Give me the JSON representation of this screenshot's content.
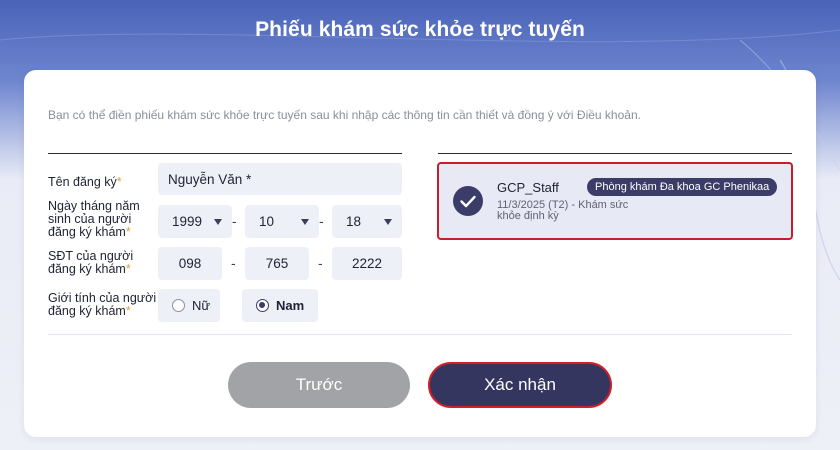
{
  "page": {
    "title": "Phiếu khám sức khỏe trực tuyến",
    "intro": "Bạn có thể điền phiếu khám sức khỏe trực tuyến sau khi nhập các thông tin cần thiết và đồng ý với Điều khoản."
  },
  "form": {
    "name_label": "Tên đăng ký",
    "name_value": "Nguyễn Văn *",
    "dob_label_l1": "Ngày tháng năm",
    "dob_label_l2": "sinh của người",
    "dob_label_l3": "đăng ký khám",
    "dob_year": "1999",
    "dob_month": "10",
    "dob_day": "18",
    "phone_label_l1": "SĐT của người",
    "phone_label_l2": "đăng ký khám",
    "phone_1": "098",
    "phone_2": "765",
    "phone_3": "2222",
    "gender_label_l1": "Giới tính của người",
    "gender_label_l2": "đăng ký khám",
    "gender_female": "Nữ",
    "gender_male": "Nam",
    "gender_selected": "Nam",
    "required_mark": "*",
    "separator": "-"
  },
  "schedule": {
    "user": "GCP_Staff",
    "clinic": "Phòng khám Đa khoa GC Phenikaa",
    "date_line": "11/3/2025  (T2)  -  Khám sức",
    "type_line": "khỏe định kỳ",
    "selected": true
  },
  "buttons": {
    "back": "Trước",
    "confirm": "Xác nhận"
  },
  "colors": {
    "primary": "#3b3d68",
    "accent_red": "#c81e2a",
    "required": "#e0a13c",
    "header_blue": "#4a63b8",
    "disabled": "#a2a3a6"
  },
  "icons": {
    "check": "check-circle-icon",
    "dropdown": "chevron-down-icon"
  }
}
